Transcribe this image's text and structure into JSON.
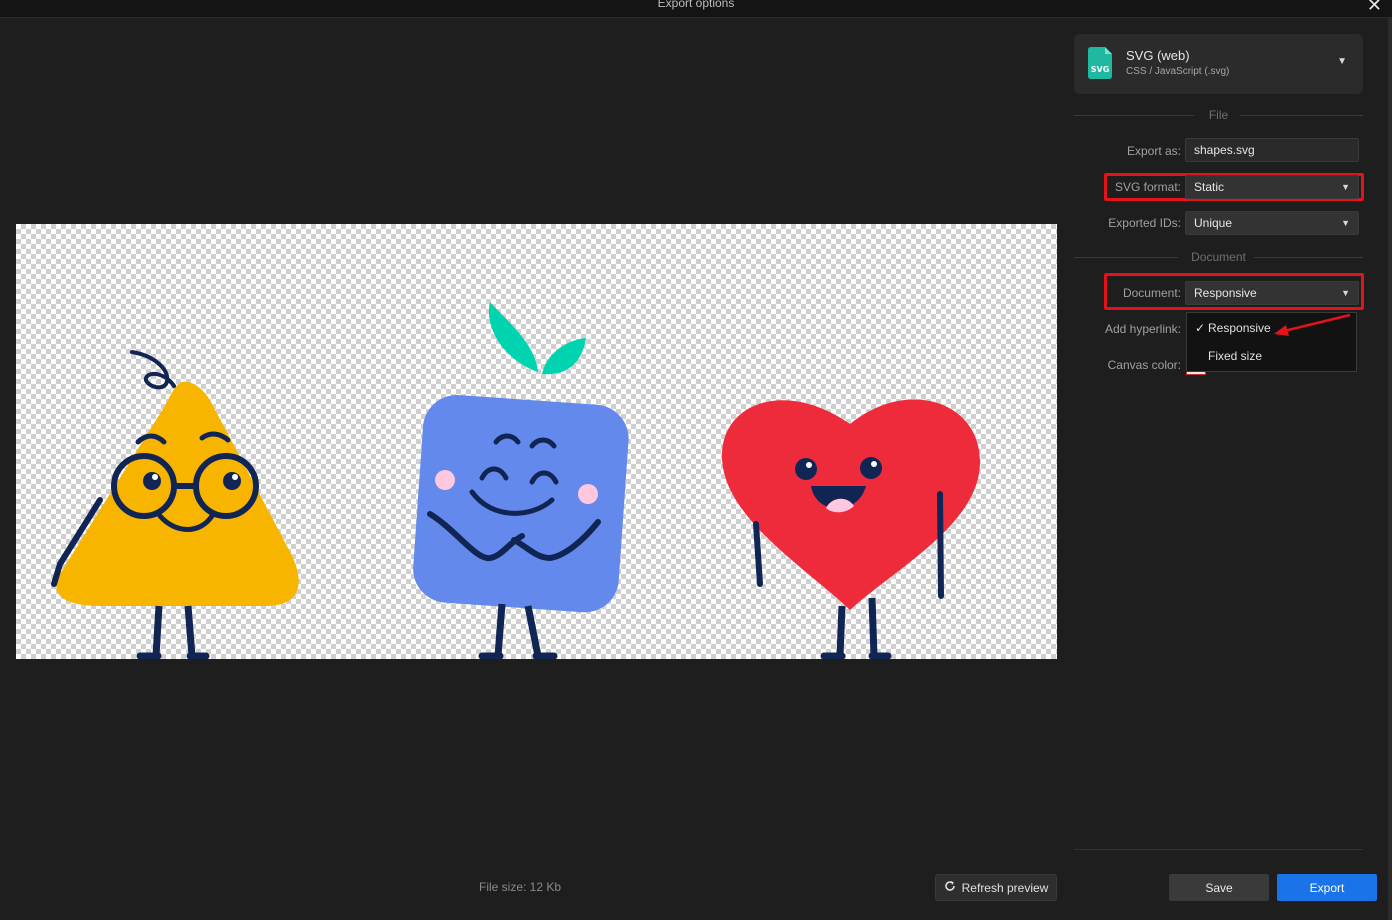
{
  "window": {
    "title": "Export options",
    "close_icon": "close-icon"
  },
  "preview": {
    "background": "transparent-checkerboard",
    "characters": [
      "pear",
      "square-with-leaves",
      "heart"
    ],
    "file_size": "File size: 12 Kb",
    "refresh_label": "Refresh preview",
    "refresh_icon": "refresh-icon"
  },
  "format": {
    "name": "SVG (web)",
    "description": "CSS / JavaScript (.svg)",
    "icon_text": "SVG",
    "icon_color": "#1fb8a0"
  },
  "sections": {
    "file": "File",
    "document": "Document"
  },
  "fields": {
    "export_as": {
      "label": "Export as:",
      "value": "shapes.svg"
    },
    "svg_format": {
      "label": "SVG format:",
      "value": "Static"
    },
    "exported_ids": {
      "label": "Exported IDs:",
      "value": "Unique"
    },
    "document": {
      "label": "Document:",
      "value": "Responsive"
    },
    "add_hyperlink": {
      "label": "Add hyperlink:"
    },
    "canvas_color": {
      "label": "Canvas color:"
    }
  },
  "document_dropdown": {
    "options": [
      {
        "label": "Responsive",
        "checked": true
      },
      {
        "label": "Fixed size",
        "checked": false
      }
    ],
    "check_mark": "✓"
  },
  "annotations": {
    "highlight_color": "#e3121b",
    "arrow_target": "Responsive"
  },
  "buttons": {
    "save": "Save",
    "export": "Export"
  },
  "colors": {
    "accent": "#1a73e8",
    "background": "#1e1e1e",
    "pear": "#f7b500",
    "square": "#6489ec",
    "leaves": "#00d3b0",
    "heart": "#ee2b3b",
    "outline": "#102553",
    "cheeks": "#ffc8df"
  }
}
